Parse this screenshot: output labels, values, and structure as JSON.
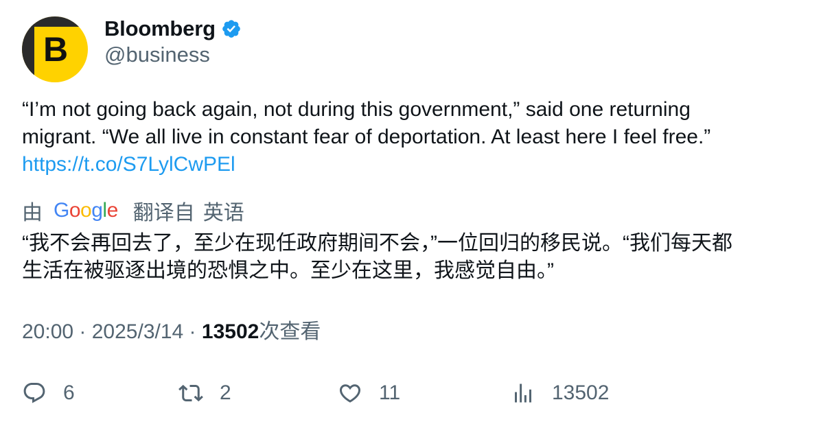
{
  "author": {
    "display_name": "Bloomberg",
    "handle": "@business",
    "avatar_letter": "B",
    "verified": true
  },
  "tweet": {
    "text": "“I’m not going back again, not during this government,” said one returning\nmigrant. “We all live in constant fear of deportation. At least here I feel free.”",
    "link": "https://t.co/S7LylCwPEl"
  },
  "translation": {
    "prefix": "由",
    "provider": "Google",
    "from_label": "翻译自",
    "source_language": "英语",
    "text": "“我不会再回去了，至少在现任政府期间不会，”一位回归的移民说。“我们每天都\n生活在被驱逐出境的恐惧之中。至少在这里，我感觉自由。”"
  },
  "meta": {
    "time": "20:00",
    "separator": " · ",
    "date": "2025/3/14",
    "views": "13502",
    "views_label": "次查看"
  },
  "actions": {
    "replies": "6",
    "retweets": "2",
    "likes": "11",
    "views": "13502"
  },
  "colors": {
    "link": "#1d9bf0",
    "secondary_text": "#536471",
    "avatar_bg": "#ffd200",
    "verified": "#1d9bf0"
  }
}
